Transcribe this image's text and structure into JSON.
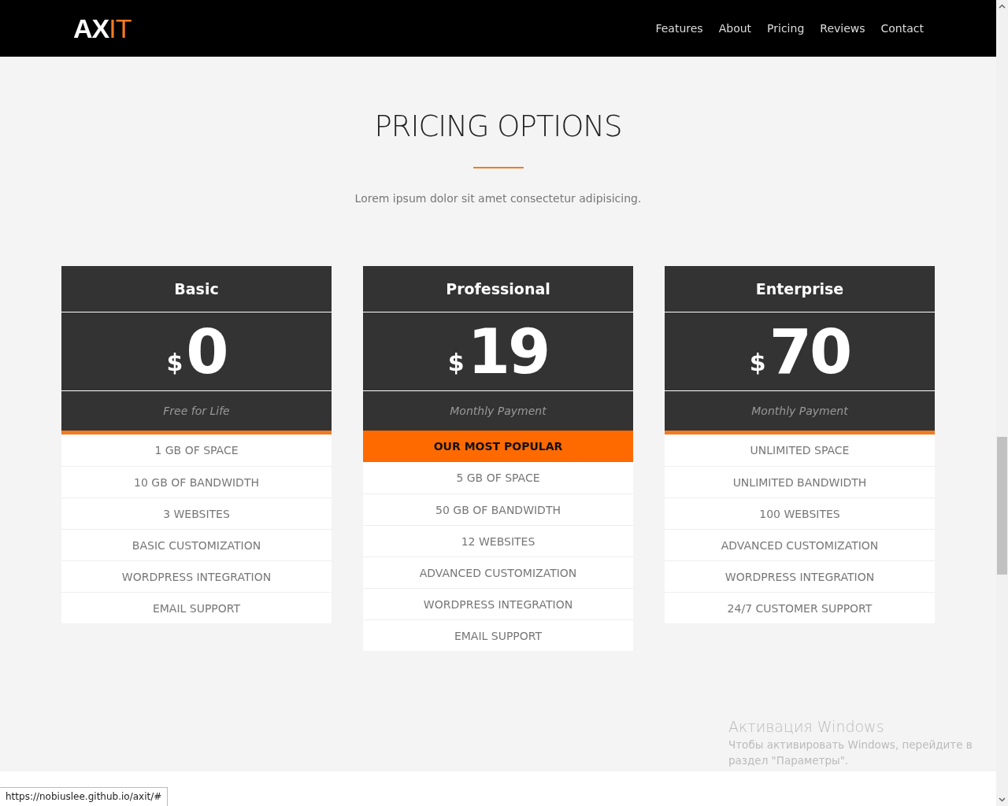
{
  "nav": {
    "logo": {
      "first": "AX",
      "second": "IT"
    },
    "links": [
      {
        "label": "Features"
      },
      {
        "label": "About"
      },
      {
        "label": "Pricing"
      },
      {
        "label": "Reviews"
      },
      {
        "label": "Contact"
      }
    ]
  },
  "section": {
    "title": "PRICING OPTIONS",
    "subtitle": "Lorem ipsum dolor sit amet consectetur adipisicing."
  },
  "plans": [
    {
      "name": "Basic",
      "currency": "$",
      "price": "0",
      "period": "Free for Life",
      "featured": false,
      "features": [
        "1 GB OF SPACE",
        "10 GB OF BANDWIDTH",
        "3 WEBSITES",
        "BASIC CUSTOMIZATION",
        "WORDPRESS INTEGRATION",
        "EMAIL SUPPORT"
      ]
    },
    {
      "name": "Professional",
      "currency": "$",
      "price": "19",
      "period": "Monthly Payment",
      "featured": true,
      "ribbon": "OUR MOST POPULAR",
      "features": [
        "5 GB OF SPACE",
        "50 GB OF BANDWIDTH",
        "12 WEBSITES",
        "ADVANCED CUSTOMIZATION",
        "WORDPRESS INTEGRATION",
        "EMAIL SUPPORT"
      ]
    },
    {
      "name": "Enterprise",
      "currency": "$",
      "price": "70",
      "period": "Monthly Payment",
      "featured": false,
      "features": [
        "UNLIMITED SPACE",
        "UNLIMITED BANDWIDTH",
        "100 WEBSITES",
        "ADVANCED CUSTOMIZATION",
        "WORDPRESS INTEGRATION",
        "24/7 CUSTOMER SUPPORT"
      ]
    }
  ],
  "activation": {
    "title": "Активация Windows",
    "message": "Чтобы активировать Windows, перейдите в раздел \"Параметры\"."
  },
  "status_bar": {
    "url": "https://nobiuslee.github.io/axit/#"
  }
}
